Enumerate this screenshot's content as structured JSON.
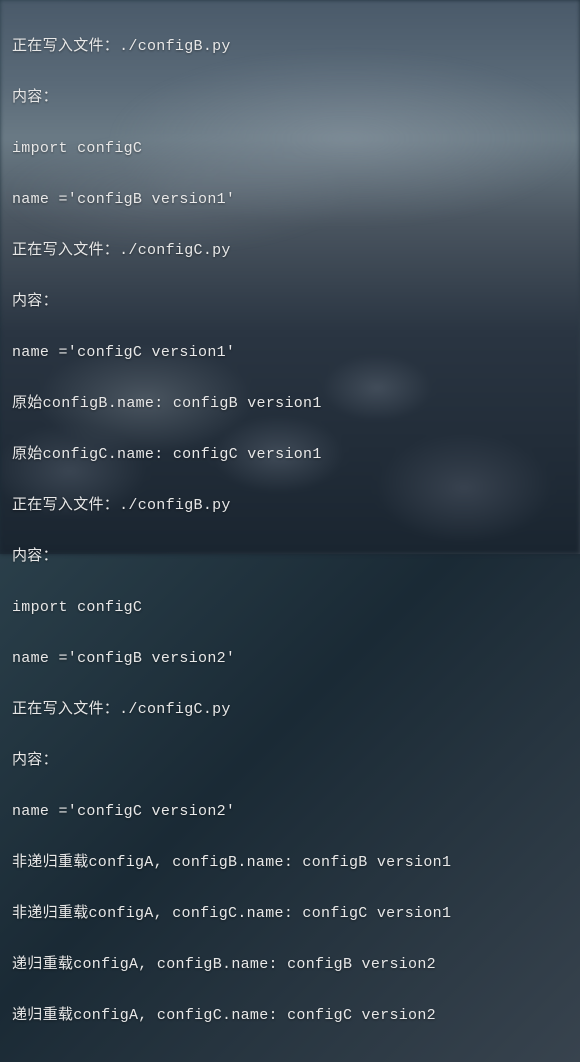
{
  "lines": [
    "正在写入文件：./configB.py",
    "内容：",
    "import configC",
    "name ='configB version1'",
    "正在写入文件：./configC.py",
    "内容：",
    "name ='configC version1'",
    "原始configB.name: configB version1",
    "原始configC.name: configC version1",
    "正在写入文件：./configB.py",
    "内容：",
    "import configC",
    "name ='configB version2'",
    "正在写入文件：./configC.py",
    "内容：",
    "name ='configC version2'",
    "非递归重载configA, configB.name: configB version1",
    "非递归重载configA, configC.name: configC version1",
    "递归重载configA, configB.name: configB version2",
    "递归重载configA, configC.name: configC version2"
  ]
}
